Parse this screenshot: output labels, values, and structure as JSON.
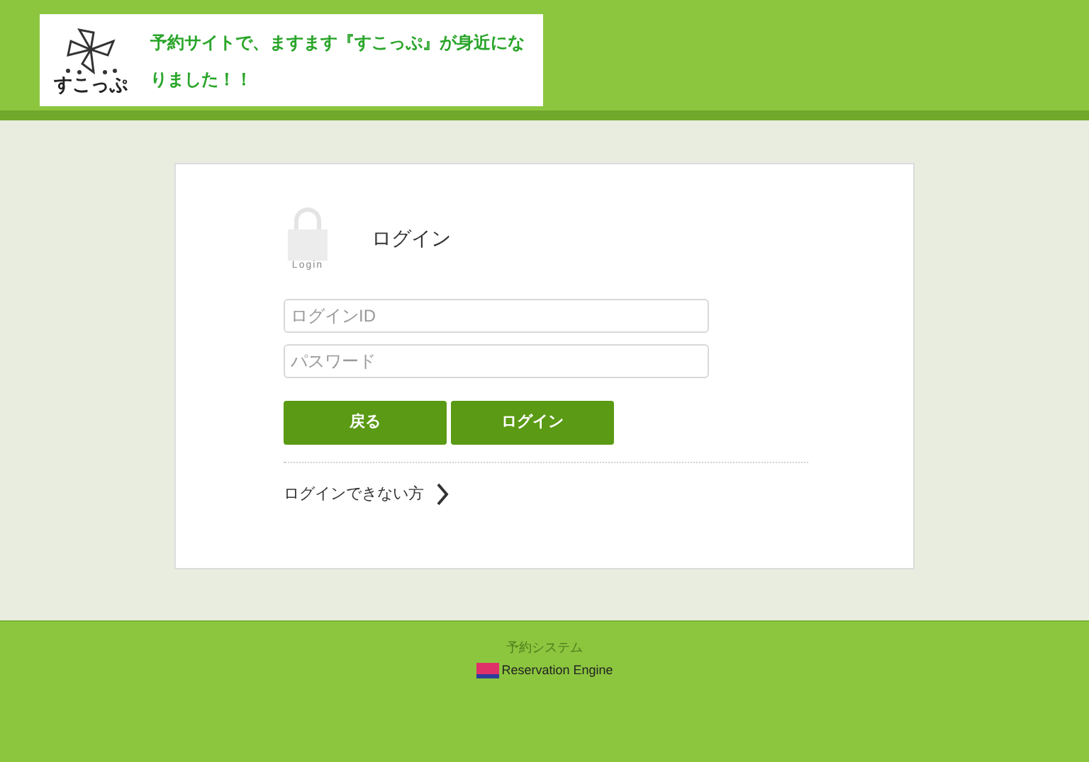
{
  "header": {
    "logo_text": "すこっぷ",
    "message": "予約サイトで、ますます『すこっぷ』が身近になりました！！"
  },
  "login": {
    "icon_caption": "Login",
    "title": "ログイン",
    "fields": [
      {
        "placeholder": "ログインID"
      },
      {
        "placeholder": "パスワード"
      }
    ],
    "buttons": [
      "戻る",
      "ログイン"
    ],
    "help_link": "ログインできない方"
  },
  "footer": {
    "label": "予約システム",
    "brand": "Reservation Engine"
  }
}
